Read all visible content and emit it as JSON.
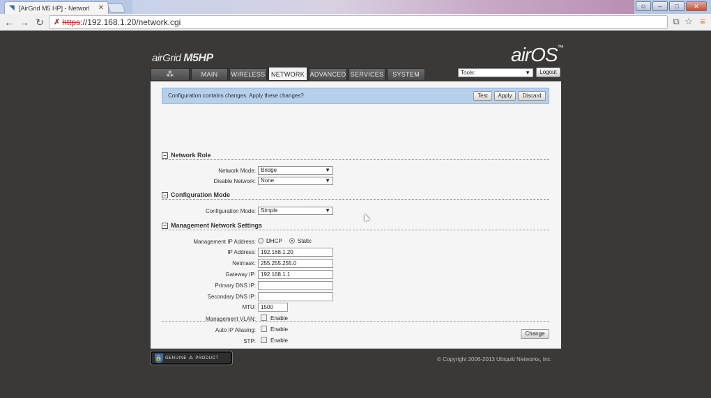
{
  "browser": {
    "tab_title": "[AirGrid M5 HP] - Networl",
    "url_protocol": "https",
    "url_rest": "://192.168.1.20/network.cgi"
  },
  "brand": {
    "product_prefix": "airGrid",
    "product_model": "M5HP",
    "os_name": "airOS",
    "os_mark": "™"
  },
  "nav": {
    "tabs": [
      "MAIN",
      "WIRELESS",
      "NETWORK",
      "ADVANCED",
      "SERVICES",
      "SYSTEM"
    ],
    "active": "NETWORK",
    "tools_label": "Tools:",
    "logout_label": "Logout"
  },
  "notice": {
    "text": "Configuration contains changes. Apply these changes?",
    "test_label": "Test",
    "apply_label": "Apply",
    "discard_label": "Discard"
  },
  "network_role": {
    "title": "Network Role",
    "network_mode_label": "Network Mode:",
    "network_mode_value": "Bridge",
    "disable_network_label": "Disable Network:",
    "disable_network_value": "None"
  },
  "configuration_mode": {
    "title": "Configuration Mode",
    "label": "Configuration Mode:",
    "value": "Simple"
  },
  "management": {
    "title": "Management Network Settings",
    "mgmt_ip_label": "Management IP Address:",
    "dhcp_label": "DHCP",
    "static_label": "Static",
    "ip_label": "IP Address:",
    "ip_value": "192.168.1.20",
    "netmask_label": "Netmask:",
    "netmask_value": "255.255.255.0",
    "gateway_label": "Gateway IP:",
    "gateway_value": "192.168.1.1",
    "primary_dns_label": "Primary DNS IP:",
    "primary_dns_value": "",
    "secondary_dns_label": "Secondary DNS IP:",
    "secondary_dns_value": "",
    "mtu_label": "MTU:",
    "mtu_value": "1500",
    "vlan_label": "Management VLAN:",
    "alias_label": "Auto IP Aliasing:",
    "stp_label": "STP:",
    "enable_label": "Enable"
  },
  "footer": {
    "change_label": "Change",
    "genuine_text": "GENUINE",
    "product_text": "PRODUCT",
    "copyright": "© Copyright 2006-2013 Ubiquiti Networks, Inc."
  }
}
